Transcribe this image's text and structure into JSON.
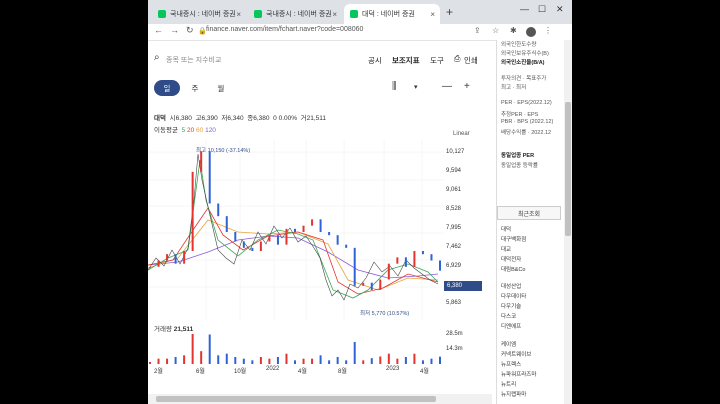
{
  "browser": {
    "tabs": [
      {
        "label": "국내증시 : 네이버 증권"
      },
      {
        "label": "국내증시 : 네이버 증권"
      },
      {
        "label": "대덕 : 네이버 증권"
      }
    ],
    "url": "finance.naver.com/item/fchart.naver?code=008060"
  },
  "toolbar": {
    "search_placeholder": "종목 또는 지수비교",
    "public_label": "공시",
    "indicator_label": "보조지표",
    "tools_label": "도구",
    "print_label": "인쇄"
  },
  "periods": [
    {
      "label": "일",
      "active": true
    },
    {
      "label": "주",
      "active": false
    },
    {
      "label": "월",
      "active": false
    }
  ],
  "quote": {
    "name": "대덕",
    "open_label": "시",
    "open": "6,380",
    "high_label": "고",
    "high": "6,390",
    "low_label": "저",
    "low": "6,340",
    "close_label": "종",
    "close": "6,380",
    "change": "0 0.00%",
    "volume_label": "거",
    "volume": "21,511"
  },
  "ma": {
    "label": "이동평균",
    "p5": "5",
    "p20": "20",
    "p60": "60",
    "p120": "120"
  },
  "scale_label": "Linear",
  "y_ticks": [
    "10,127",
    "9,594",
    "9,061",
    "8,528",
    "7,995",
    "7,462",
    "6,929",
    "5,863"
  ],
  "current_price_badge": "6,380",
  "annotations": {
    "high": "최고 10,150 (-37.14%)",
    "low": "최저 5,770 (10.57%)"
  },
  "volume_panel": {
    "label": "거래량",
    "value": "21,511",
    "ticks": [
      "28.5m",
      "14.3m"
    ]
  },
  "x_ticks": [
    "2월",
    "6월",
    "10월",
    "2022",
    "4월",
    "8월",
    "2023",
    "4월"
  ],
  "colors": {
    "accent": "#2f4b88",
    "up": "#e3342f",
    "down": "#2e62d6"
  },
  "sidebar": {
    "top_items": [
      "외국인한도수량",
      "외국인보유주식수(B)",
      "외국인소진율(B/A)",
      "투자의견 · 목표주가",
      "최고 · 최저",
      "PER · EPS(2022.12)",
      "추정PER · EPS",
      "PBR · BPS (2022.12)",
      "배당수익률 · 2022.12",
      "동일업종 PER",
      "동일업종 등락률"
    ],
    "recent_tab": "최근조회",
    "recent_items": [
      "대덕",
      "대구백화점",
      "대교",
      "대덕전자",
      "대림B&Co",
      "대성산업",
      "다우데이타",
      "다우기술",
      "다스코",
      "디엔에프",
      "케이엠",
      "커넥트웨이브",
      "뉴프렉스",
      "뉴파워프라즈마",
      "뉴트리",
      "뉴지랩파마"
    ]
  },
  "chart_data": {
    "type": "candlestick",
    "x_ticks": [
      "2월",
      "6월",
      "10월",
      "2022",
      "4월",
      "8월",
      "2023",
      "4월"
    ],
    "ylim": [
      5600,
      10400
    ],
    "price_close_approx": [
      6500,
      6700,
      6900,
      6600,
      7000,
      9500,
      10150,
      8500,
      8100,
      7600,
      7300,
      7100,
      7000,
      7300,
      7500,
      7200,
      7700,
      7600,
      7800,
      8000,
      7600,
      7500,
      7200,
      7100,
      5900,
      6000,
      5770,
      6100,
      6600,
      6800,
      6500,
      7000,
      6900,
      6700,
      6380
    ],
    "high": 10150,
    "low": 5770,
    "last": 6380,
    "scale": "Linear"
  }
}
